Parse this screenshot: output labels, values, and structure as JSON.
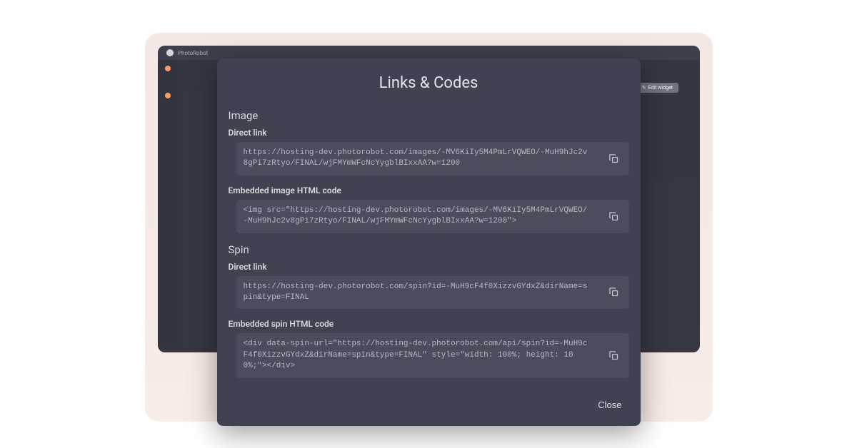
{
  "background": {
    "app_name": "PhotoRobot",
    "edit_widget_label": "Edit widget"
  },
  "modal": {
    "title": "Links & Codes",
    "image_section": {
      "title": "Image",
      "direct_link": {
        "label": "Direct link",
        "value": "https://hosting-dev.photorobot.com/images/-MV6KiIy5M4PmLrVQWEO/-MuH9hJc2v8gPi7zRtyo/FINAL/wjFMYmWFcNcYygblBIxxAA?w=1200"
      },
      "embedded": {
        "label": "Embedded image HTML code",
        "value": "<img src=\"https://hosting-dev.photorobot.com/images/-MV6KiIy5M4PmLrVQWEO/-MuH9hJc2v8gPi7zRtyo/FINAL/wjFMYmWFcNcYygblBIxxAA?w=1200\">"
      }
    },
    "spin_section": {
      "title": "Spin",
      "direct_link": {
        "label": "Direct link",
        "value": "https://hosting-dev.photorobot.com/spin?id=-MuH9cF4f0XizzvGYdxZ&dirName=spin&type=FINAL"
      },
      "embedded": {
        "label": "Embedded spin HTML code",
        "value": "<div data-spin-url=\"https://hosting-dev.photorobot.com/api/spin?id=-MuH9cF4f0XizzvGYdxZ&dirName=spin&type=FINAL\" style=\"width: 100%; height: 100%;\"></div>"
      }
    },
    "close_label": "Close"
  }
}
